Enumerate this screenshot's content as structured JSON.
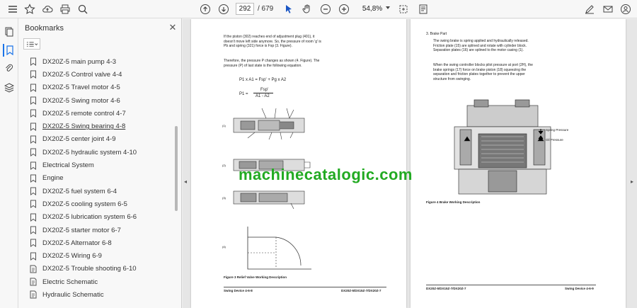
{
  "toolbar": {
    "page_current": "292",
    "page_total": "/ 679",
    "zoom": "54,8%"
  },
  "bookmarks": {
    "title": "Bookmarks",
    "items": [
      {
        "label": "DX20Z-5 main pump 4-3",
        "icon": "bookmark-icon"
      },
      {
        "label": "DX20Z-5 Control valve 4-4",
        "icon": "bookmark-icon"
      },
      {
        "label": "DX20Z-5 Travel motor 4-5",
        "icon": "bookmark-icon"
      },
      {
        "label": "DX20Z-5 Swing motor 4-6",
        "icon": "bookmark-icon"
      },
      {
        "label": "DX20Z-5 remote control 4-7",
        "icon": "bookmark-icon"
      },
      {
        "label": "DX20Z-5 Swing bearing 4-8",
        "icon": "bookmark-icon"
      },
      {
        "label": "DX20Z-5 center joint 4-9",
        "icon": "bookmark-icon"
      },
      {
        "label": "DX20Z-5 hydraulic system 4-10",
        "icon": "bookmark-icon"
      },
      {
        "label": "Electrical System",
        "icon": "bookmark-icon"
      },
      {
        "label": "Engine",
        "icon": "bookmark-icon"
      },
      {
        "label": "DX20Z-5  fuel system 6-4",
        "icon": "bookmark-icon"
      },
      {
        "label": "DX20Z-5  cooling system 6-5",
        "icon": "bookmark-icon"
      },
      {
        "label": "DX20Z-5  lubrication system 6-6",
        "icon": "bookmark-icon"
      },
      {
        "label": "DX20Z-5  starter motor 6-7",
        "icon": "bookmark-icon"
      },
      {
        "label": "DX20Z-5  Alternator 6-8",
        "icon": "bookmark-icon"
      },
      {
        "label": "DX20Z-5  Wiring 6-9",
        "icon": "bookmark-icon"
      },
      {
        "label": "DX20Z-5  Trouble shooting 6-10",
        "icon": "bookmark-doc-icon"
      },
      {
        "label": "Electric Schematic",
        "icon": "bookmark-doc-icon"
      },
      {
        "label": "Hydraulic Schematic",
        "icon": "bookmark-doc-icon"
      }
    ]
  },
  "page_left": {
    "para1": "If the piston (302) reaches end of adjustment plug (401), it doesn't move left side anymore. So, the pressure of room 'g' is Pb and spring (321) force is Fsp (3. Figure).",
    "para2": "Therefore, the pressure P changes as shown (4. Figure). The pressure (P) of last state is the following equation.",
    "eq1": "P1 x A1 = Fsp' + Pg x A2",
    "eq2_left": "P1 =",
    "eq2_num": "Fsp'",
    "eq2_den": "A1 - A2",
    "figure_caption": "Figure 3 Relief Valve Working Description",
    "footer_left": "Swing Device 4-6-8",
    "footer_right": "DX20Z-5/DX15Z-7/DX20Z-7"
  },
  "page_right": {
    "heading": "3. Brake Part",
    "para1": "The swing brake is spring applied and hydraulically released. Friction plate (15) are splined and rotate with cylinder block. Separation plates (16) are splined to the motor casing (1).",
    "para2": "When the swing controller blocks pilot pressure at port (2H), the brake springs (17) force on brake piston (18) squeezing the separation and friction plates together to prevent the upper structure from swinging.",
    "legend_spring": "Spring Pressure",
    "legend_oil": "Oil Pressure",
    "figure_caption": "Figure 4 Brake Working Description",
    "footer_left": "DX20Z-5/DX15Z-7/DX20Z-7",
    "footer_right": "Swing Device 4-6-9"
  },
  "watermark": "machinecatalogic.com"
}
